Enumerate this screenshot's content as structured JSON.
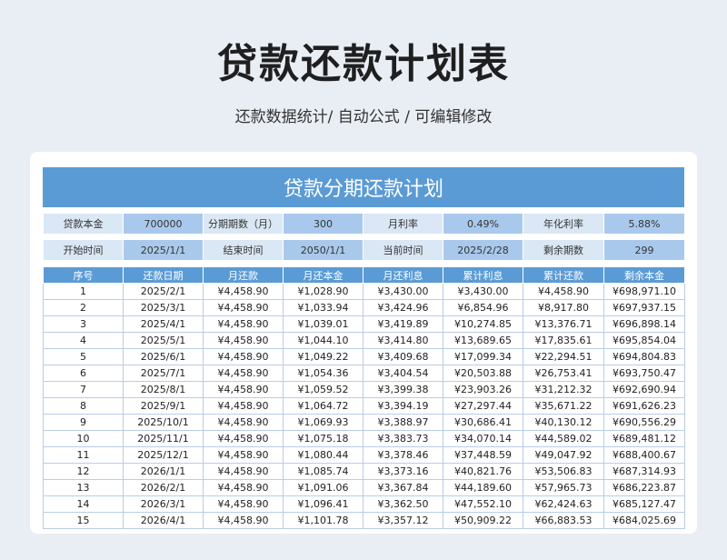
{
  "page": {
    "title": "贷款还款计划表",
    "subtitle": "还款数据统计/ 自动公式 / 可编辑修改"
  },
  "sheet": {
    "banner": "贷款分期还款计划",
    "info_rows": [
      [
        {
          "label": "贷款本金",
          "value": "700000"
        },
        {
          "label": "分期期数（月）",
          "value": "300"
        },
        {
          "label": "月利率",
          "value": "0.49%"
        },
        {
          "label": "年化利率",
          "value": "5.88%"
        }
      ],
      [
        {
          "label": "开始时间",
          "value": "2025/1/1"
        },
        {
          "label": "结束时间",
          "value": "2050/1/1"
        },
        {
          "label": "当前时间",
          "value": "2025/2/28"
        },
        {
          "label": "剩余期数",
          "value": "299"
        }
      ]
    ],
    "columns": [
      "序号",
      "还款日期",
      "月还款",
      "月还本金",
      "月还利息",
      "累计利息",
      "累计还款",
      "剩余本金"
    ],
    "rows": [
      [
        "1",
        "2025/2/1",
        "¥4,458.90",
        "¥1,028.90",
        "¥3,430.00",
        "¥3,430.00",
        "¥4,458.90",
        "¥698,971.10"
      ],
      [
        "2",
        "2025/3/1",
        "¥4,458.90",
        "¥1,033.94",
        "¥3,424.96",
        "¥6,854.96",
        "¥8,917.80",
        "¥697,937.15"
      ],
      [
        "3",
        "2025/4/1",
        "¥4,458.90",
        "¥1,039.01",
        "¥3,419.89",
        "¥10,274.85",
        "¥13,376.71",
        "¥696,898.14"
      ],
      [
        "4",
        "2025/5/1",
        "¥4,458.90",
        "¥1,044.10",
        "¥3,414.80",
        "¥13,689.65",
        "¥17,835.61",
        "¥695,854.04"
      ],
      [
        "5",
        "2025/6/1",
        "¥4,458.90",
        "¥1,049.22",
        "¥3,409.68",
        "¥17,099.34",
        "¥22,294.51",
        "¥694,804.83"
      ],
      [
        "6",
        "2025/7/1",
        "¥4,458.90",
        "¥1,054.36",
        "¥3,404.54",
        "¥20,503.88",
        "¥26,753.41",
        "¥693,750.47"
      ],
      [
        "7",
        "2025/8/1",
        "¥4,458.90",
        "¥1,059.52",
        "¥3,399.38",
        "¥23,903.26",
        "¥31,212.32",
        "¥692,690.94"
      ],
      [
        "8",
        "2025/9/1",
        "¥4,458.90",
        "¥1,064.72",
        "¥3,394.19",
        "¥27,297.44",
        "¥35,671.22",
        "¥691,626.23"
      ],
      [
        "9",
        "2025/10/1",
        "¥4,458.90",
        "¥1,069.93",
        "¥3,388.97",
        "¥30,686.41",
        "¥40,130.12",
        "¥690,556.29"
      ],
      [
        "10",
        "2025/11/1",
        "¥4,458.90",
        "¥1,075.18",
        "¥3,383.73",
        "¥34,070.14",
        "¥44,589.02",
        "¥689,481.12"
      ],
      [
        "11",
        "2025/12/1",
        "¥4,458.90",
        "¥1,080.44",
        "¥3,378.46",
        "¥37,448.59",
        "¥49,047.92",
        "¥688,400.67"
      ],
      [
        "12",
        "2026/1/1",
        "¥4,458.90",
        "¥1,085.74",
        "¥3,373.16",
        "¥40,821.76",
        "¥53,506.83",
        "¥687,314.93"
      ],
      [
        "13",
        "2026/2/1",
        "¥4,458.90",
        "¥1,091.06",
        "¥3,367.84",
        "¥44,189.60",
        "¥57,965.73",
        "¥686,223.87"
      ],
      [
        "14",
        "2026/3/1",
        "¥4,458.90",
        "¥1,096.41",
        "¥3,362.50",
        "¥47,552.10",
        "¥62,424.63",
        "¥685,127.47"
      ],
      [
        "15",
        "2026/4/1",
        "¥4,458.90",
        "¥1,101.78",
        "¥3,357.12",
        "¥50,909.22",
        "¥66,883.53",
        "¥684,025.69"
      ]
    ]
  }
}
